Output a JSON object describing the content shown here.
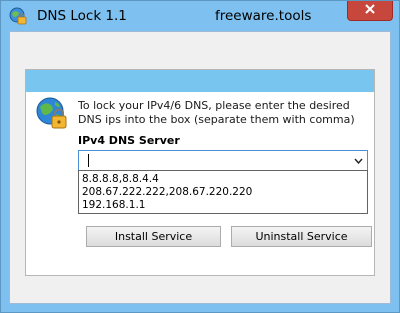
{
  "window": {
    "title": "DNS Lock 1.1",
    "site": "freeware.tools",
    "close_icon": "close-icon"
  },
  "panel": {
    "instructions": "To lock your IPv4/6 DNS, please enter the desired DNS ips into the box (separate them with comma)",
    "server_label": "IPv4 DNS Server",
    "combo_value": "",
    "dropdown_options": [
      "8.8.8.8,8.8.4.4",
      "208.67.222.222,208.67.220.220",
      "192.168.1.1"
    ]
  },
  "buttons": {
    "install": "Install Service",
    "uninstall": "Uninstall Service"
  },
  "colors": {
    "frame": "#7ec1f0",
    "header_band": "#78c6f0",
    "close": "#c7473d"
  }
}
